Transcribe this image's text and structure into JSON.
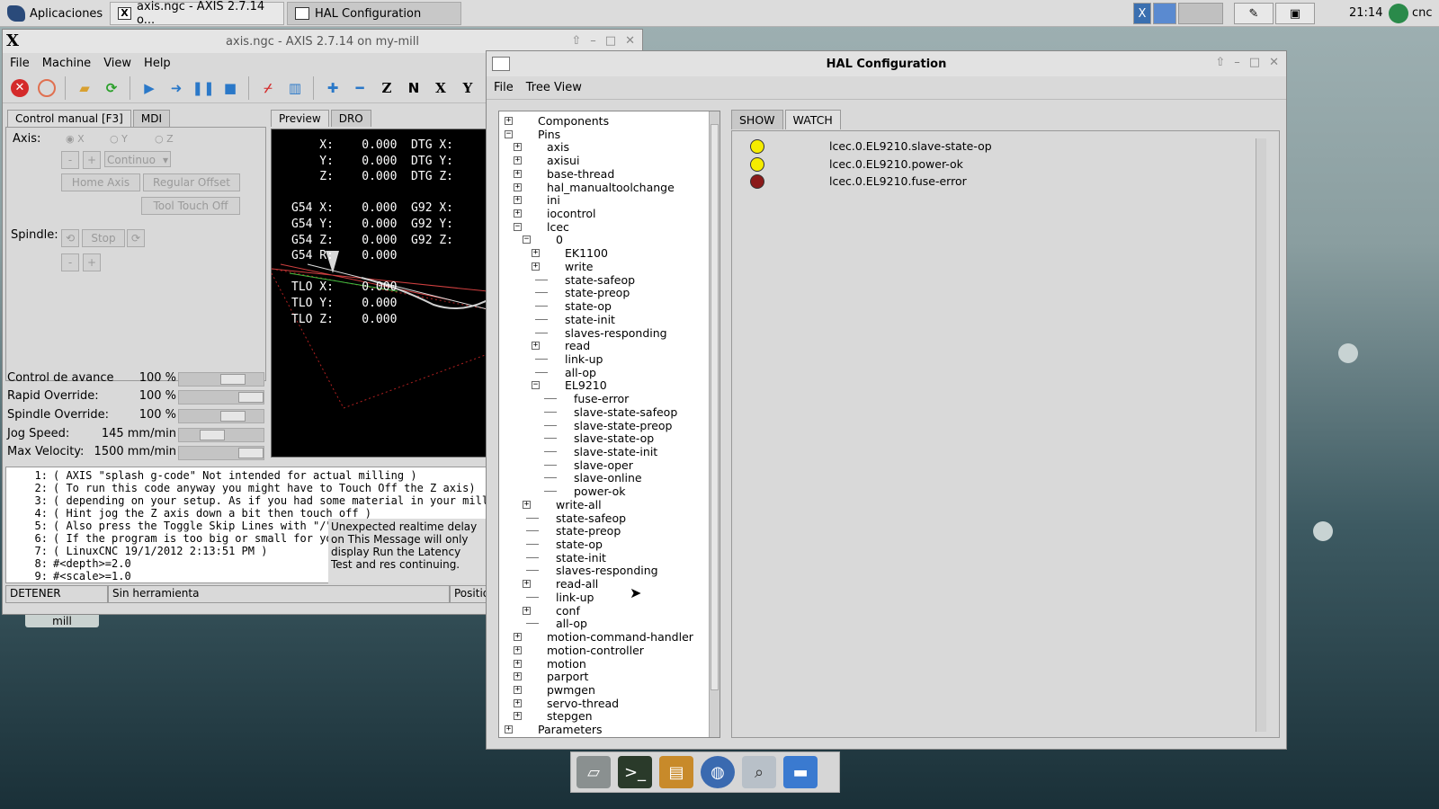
{
  "top_panel": {
    "apps_label": "Aplicaciones",
    "tasks": [
      {
        "label": "axis.ngc - AXIS 2.7.14 o...",
        "icon": "X"
      },
      {
        "label": "HAL Configuration"
      }
    ],
    "clock": "21:14",
    "user": "cnc"
  },
  "desktop": {
    "icon_label": "mill"
  },
  "axis": {
    "title": "axis.ngc - AXIS 2.7.14 on my-mill",
    "logo": "X",
    "menu": [
      "File",
      "Machine",
      "View",
      "Help"
    ],
    "toolbar_letters": [
      "Z",
      "X",
      "Y"
    ],
    "tabs_left": [
      "Control manual [F3]",
      "MDI"
    ],
    "tabs_right": [
      "Preview",
      "DRO"
    ],
    "axis_label": "Axis:",
    "axes": [
      "X",
      "Y",
      "Z"
    ],
    "jog_minus": "-",
    "jog_plus": "+",
    "jog_mode": "Continuo",
    "home_axis": "Home Axis",
    "regular_offset": "Regular Offset",
    "tool_touch_off": "Tool Touch Off",
    "spindle_label": "Spindle:",
    "stop": "Stop",
    "overrides": [
      {
        "label": "Control de avance",
        "value": "100 %",
        "fraction": 0.7
      },
      {
        "label": "Rapid Override:",
        "value": "100 %",
        "fraction": 1.0
      },
      {
        "label": "Spindle Override:",
        "value": "100 %",
        "fraction": 0.7
      },
      {
        "label": "Jog Speed:",
        "value": "145 mm/min",
        "fraction": 0.35
      },
      {
        "label": "Max Velocity:",
        "value": "1500 mm/min",
        "fraction": 1.0
      }
    ],
    "dro": [
      "    X:    0.000  DTG X:",
      "    Y:    0.000  DTG Y:",
      "    Z:    0.000  DTG Z:",
      "",
      "G54 X:    0.000  G92 X:",
      "G54 Y:    0.000  G92 Y:",
      "G54 Z:    0.000  G92 Z:",
      "G54 R:    0.000",
      "",
      "TLO X:    0.000",
      "TLO Y:    0.000",
      "TLO Z:    0.000"
    ],
    "code": [
      {
        "n": "1:",
        "t": "( AXIS \"splash g-code\" Not intended for actual milling )"
      },
      {
        "n": "2:",
        "t": "( To run this code anyway you might have to Touch Off the Z axis)"
      },
      {
        "n": "3:",
        "t": "( depending on your setup. As if you had some material in your mill..."
      },
      {
        "n": "4:",
        "t": "( Hint jog the Z axis down a bit then touch off )"
      },
      {
        "n": "5:",
        "t": "( Also press the Toggle Skip Lines with \"/\" "
      },
      {
        "n": "6:",
        "t": "( If the program is too big or small for you"
      },
      {
        "n": "7:",
        "t": "( LinuxCNC 19/1/2012 2:13:51 PM )"
      },
      {
        "n": "8:",
        "t": "#<depth>=2.0"
      },
      {
        "n": "9:",
        "t": "#<scale>=1.0"
      }
    ],
    "latency_msg": "Unexpected realtime delay on This Message will only display Run the Latency Test and res continuing.",
    "status": [
      "DETENER",
      "Sin herramienta",
      "Position"
    ]
  },
  "hal": {
    "title": "HAL Configuration",
    "menu": [
      "File",
      "Tree View"
    ],
    "tabs": [
      "SHOW",
      "WATCH"
    ],
    "tree": [
      {
        "label": "Components",
        "depth": 0,
        "exp": "+"
      },
      {
        "label": "Pins",
        "depth": 0,
        "exp": "-"
      },
      {
        "label": "axis",
        "depth": 1,
        "exp": "+"
      },
      {
        "label": "axisui",
        "depth": 1,
        "exp": "+"
      },
      {
        "label": "base-thread",
        "depth": 1,
        "exp": "+"
      },
      {
        "label": "hal_manualtoolchange",
        "depth": 1,
        "exp": "+"
      },
      {
        "label": "ini",
        "depth": 1,
        "exp": "+"
      },
      {
        "label": "iocontrol",
        "depth": 1,
        "exp": "+"
      },
      {
        "label": "lcec",
        "depth": 1,
        "exp": "-"
      },
      {
        "label": "0",
        "depth": 2,
        "exp": "-"
      },
      {
        "label": "EK1100",
        "depth": 3,
        "exp": "+"
      },
      {
        "label": "write",
        "depth": 3,
        "exp": "+"
      },
      {
        "label": "state-safeop",
        "depth": 3,
        "exp": ""
      },
      {
        "label": "state-preop",
        "depth": 3,
        "exp": ""
      },
      {
        "label": "state-op",
        "depth": 3,
        "exp": ""
      },
      {
        "label": "state-init",
        "depth": 3,
        "exp": ""
      },
      {
        "label": "slaves-responding",
        "depth": 3,
        "exp": ""
      },
      {
        "label": "read",
        "depth": 3,
        "exp": "+"
      },
      {
        "label": "link-up",
        "depth": 3,
        "exp": ""
      },
      {
        "label": "all-op",
        "depth": 3,
        "exp": ""
      },
      {
        "label": "EL9210",
        "depth": 3,
        "exp": "-"
      },
      {
        "label": "fuse-error",
        "depth": 4,
        "exp": ""
      },
      {
        "label": "slave-state-safeop",
        "depth": 4,
        "exp": ""
      },
      {
        "label": "slave-state-preop",
        "depth": 4,
        "exp": ""
      },
      {
        "label": "slave-state-op",
        "depth": 4,
        "exp": ""
      },
      {
        "label": "slave-state-init",
        "depth": 4,
        "exp": ""
      },
      {
        "label": "slave-oper",
        "depth": 4,
        "exp": ""
      },
      {
        "label": "slave-online",
        "depth": 4,
        "exp": ""
      },
      {
        "label": "power-ok",
        "depth": 4,
        "exp": ""
      },
      {
        "label": "write-all",
        "depth": 2,
        "exp": "+"
      },
      {
        "label": "state-safeop",
        "depth": 2,
        "exp": ""
      },
      {
        "label": "state-preop",
        "depth": 2,
        "exp": ""
      },
      {
        "label": "state-op",
        "depth": 2,
        "exp": ""
      },
      {
        "label": "state-init",
        "depth": 2,
        "exp": ""
      },
      {
        "label": "slaves-responding",
        "depth": 2,
        "exp": ""
      },
      {
        "label": "read-all",
        "depth": 2,
        "exp": "+"
      },
      {
        "label": "link-up",
        "depth": 2,
        "exp": ""
      },
      {
        "label": "conf",
        "depth": 2,
        "exp": "+"
      },
      {
        "label": "all-op",
        "depth": 2,
        "exp": ""
      },
      {
        "label": "motion-command-handler",
        "depth": 1,
        "exp": "+"
      },
      {
        "label": "motion-controller",
        "depth": 1,
        "exp": "+"
      },
      {
        "label": "motion",
        "depth": 1,
        "exp": "+"
      },
      {
        "label": "parport",
        "depth": 1,
        "exp": "+"
      },
      {
        "label": "pwmgen",
        "depth": 1,
        "exp": "+"
      },
      {
        "label": "servo-thread",
        "depth": 1,
        "exp": "+"
      },
      {
        "label": "stepgen",
        "depth": 1,
        "exp": "+"
      },
      {
        "label": "Parameters",
        "depth": 0,
        "exp": "+"
      }
    ],
    "watch": [
      {
        "name": "lcec.0.EL9210.slave-state-op",
        "color": "#f5ec00"
      },
      {
        "name": "lcec.0.EL9210.power-ok",
        "color": "#f5ec00"
      },
      {
        "name": "lcec.0.EL9210.fuse-error",
        "color": "#8b1a1a"
      }
    ]
  },
  "colors": {
    "stop_red": "#d42a2a",
    "blue_tool": "#2a78c8",
    "green_tool": "#2aa02a"
  }
}
